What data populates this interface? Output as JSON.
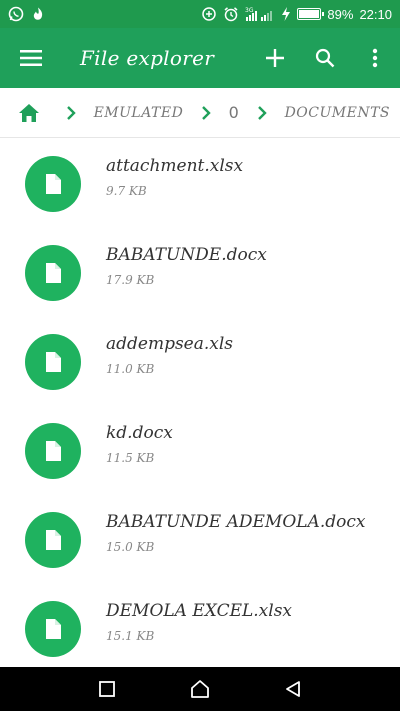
{
  "status_bar": {
    "battery": "89%",
    "battery_level": 0.89,
    "time": "22:10",
    "network": "3G",
    "left_icons": [
      "whatsapp-icon",
      "fire-app-icon"
    ],
    "right_icons": [
      "data-saver-icon",
      "alarm-icon",
      "signal-icon",
      "charging-icon",
      "battery-icon"
    ]
  },
  "app_bar": {
    "title": "File explorer",
    "menu_icon": "hamburger-menu-icon",
    "actions": [
      "add-icon",
      "search-icon",
      "more-vert-icon"
    ]
  },
  "breadcrumb": {
    "home_icon": "home-icon",
    "items": [
      "EMULATED",
      "0",
      "DOCUMENTS"
    ]
  },
  "files": [
    {
      "name": "attachment.xlsx",
      "size": "9.7 KB"
    },
    {
      "name": "BABATUNDE.docx",
      "size": "17.9 KB"
    },
    {
      "name": "addempsea.xls",
      "size": "11.0 KB"
    },
    {
      "name": "kd.docx",
      "size": "11.5 KB"
    },
    {
      "name": "BABATUNDE ADEMOLA.docx",
      "size": "15.0 KB"
    },
    {
      "name": "DEMOLA EXCEL.xlsx",
      "size": "15.1 KB"
    }
  ],
  "colors": {
    "status_bar": "#1f9a4e",
    "app_bar": "#1fa05a",
    "accent": "#1fb25f",
    "nav_bar": "#000000"
  },
  "nav_bar": [
    "recent-apps-icon",
    "home-nav-icon",
    "back-icon"
  ]
}
